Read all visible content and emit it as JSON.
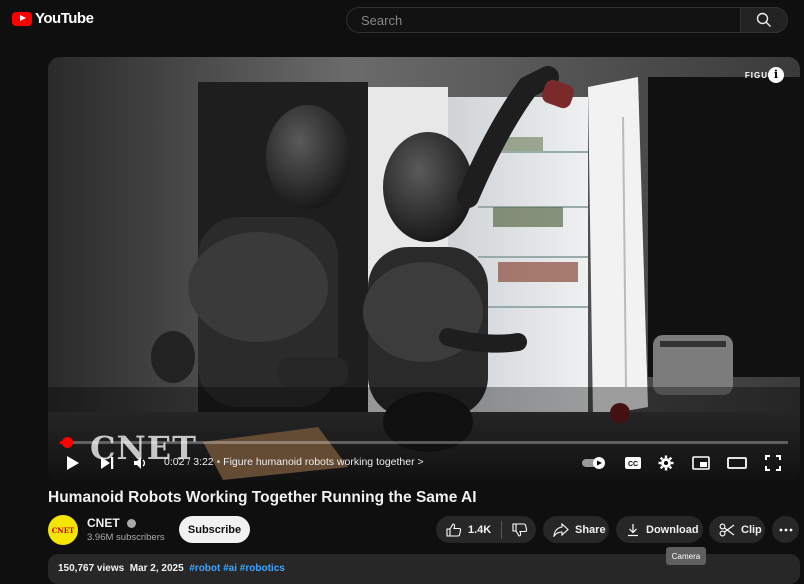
{
  "header": {
    "logo_text": "YouTube",
    "search_placeholder": "Search"
  },
  "player": {
    "overlay_brand": "FIGU",
    "watermark": "CNET",
    "time_current": "0:02",
    "time_total": "3:22",
    "chapter": "Figure humanoid robots working together",
    "progress": 0.01,
    "icons": [
      "play-icon",
      "next-icon",
      "volume-icon",
      "autoplay-toggle-icon",
      "cc-icon",
      "settings-icon",
      "miniplayer-icon",
      "theater-icon",
      "fullscreen-icon"
    ]
  },
  "video": {
    "title": "Humanoid Robots Working Together Running the Same AI"
  },
  "channel": {
    "avatar_text": "CNET",
    "name": "CNET",
    "subscribers": "3.96M subscribers",
    "subscribe_label": "Subscribe"
  },
  "actions": {
    "like_count": "1.4K",
    "share_label": "Share",
    "download_label": "Download",
    "clip_label": "Clip",
    "tooltip": "Camera"
  },
  "description": {
    "views": "150,767 views",
    "date": "Mar 2, 2025",
    "tags": "#robot #ai #robotics"
  },
  "colors": {
    "accent": "#ff0000",
    "background": "#0f0f0f",
    "link": "#3ea6ff",
    "chip": "#272727"
  }
}
